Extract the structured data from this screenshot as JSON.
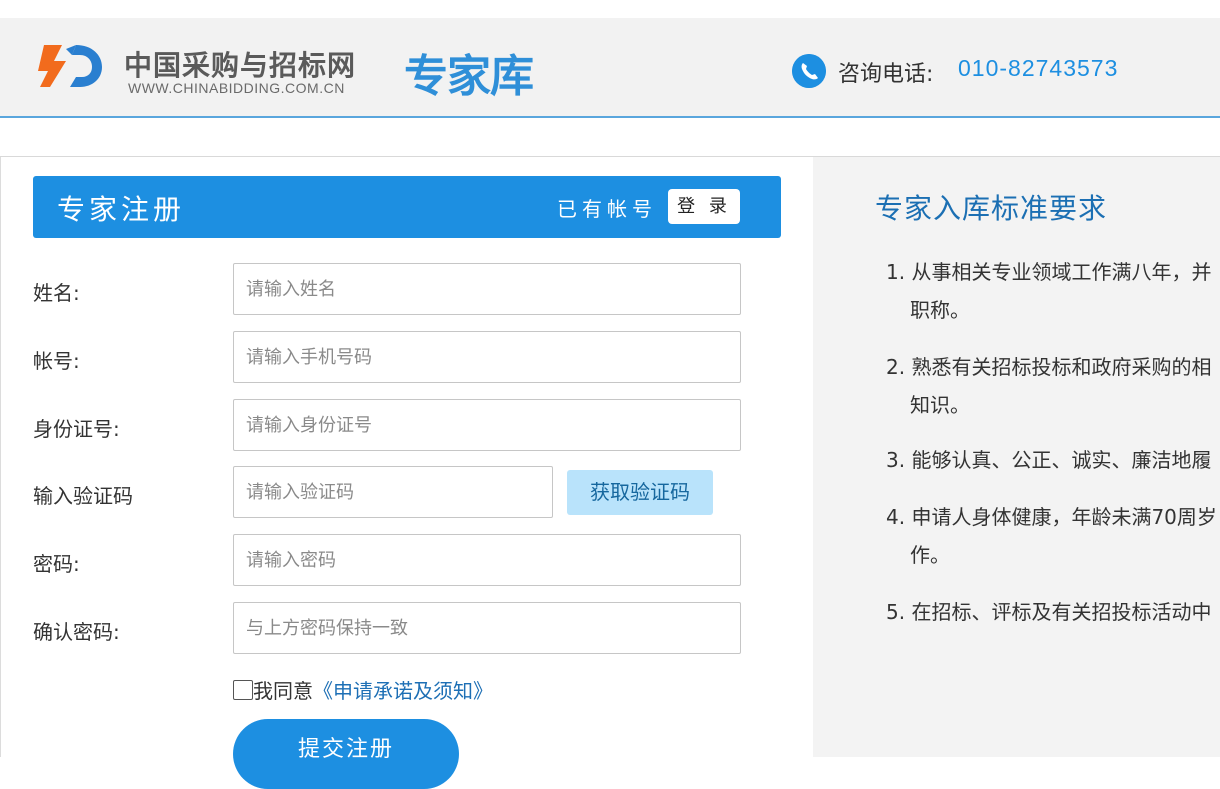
{
  "header": {
    "logo_cn": "中国采购与招标网",
    "logo_url": "WWW.CHINABIDDING.COM.CN",
    "logo_expert": "专家库",
    "phone_label": "咨询电话:",
    "phone_number": "010-82743573"
  },
  "form": {
    "title": "专家注册",
    "have_account": "已有帐号",
    "login_label": "登 录",
    "fields": [
      {
        "label": "姓名:",
        "placeholder": "请输入姓名"
      },
      {
        "label": "帐号:",
        "placeholder": "请输入手机号码"
      },
      {
        "label": "身份证号:",
        "placeholder": "请输入身份证号"
      },
      {
        "label": "输入验证码",
        "placeholder": "请输入验证码"
      },
      {
        "label": "密码:",
        "placeholder": "请输入密码"
      },
      {
        "label": "确认密码:",
        "placeholder": "与上方密码保持一致"
      }
    ],
    "get_code_label": "获取验证码",
    "agree_text": "我同意",
    "agree_link": "《申请承诺及须知》",
    "submit_label": "提交注册"
  },
  "requirements": {
    "title": "专家入库标准要求",
    "items": [
      {
        "num": "1.",
        "line1": "从事相关专业领域工作满八年，并",
        "line2": "职称。"
      },
      {
        "num": "2.",
        "line1": "熟悉有关招标投标和政府采购的相",
        "line2": "知识。"
      },
      {
        "num": "3.",
        "line1": "能够认真、公正、诚实、廉洁地履",
        "line2": ""
      },
      {
        "num": "4.",
        "line1": "申请人身体健康，年龄未满70周岁",
        "line2": "作。"
      },
      {
        "num": "5.",
        "line1": "在招标、评标及有关招投标活动中",
        "line2": ""
      }
    ]
  },
  "colors": {
    "primary": "#1d8fe1",
    "code_button_bg": "#b9e3fb",
    "link": "#1d6fb5",
    "requirements_title": "#1b6fb3"
  },
  "icons": [
    "china-bidding-logo-icon",
    "phone-icon"
  ]
}
